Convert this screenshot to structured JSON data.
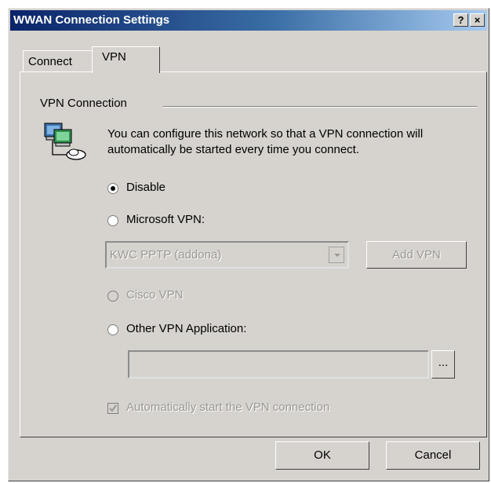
{
  "window": {
    "title": "WWAN Connection Settings",
    "help_label": "?",
    "close_label": "×"
  },
  "tabs": [
    {
      "label": "Connect"
    },
    {
      "label": "VPN"
    }
  ],
  "group": {
    "label": "VPN Connection",
    "description": "You can configure this network so that a VPN connection will automatically be started every time you connect."
  },
  "options": {
    "disable": {
      "label": "Disable",
      "selected": true
    },
    "microsoft_vpn": {
      "label": "Microsoft VPN:",
      "selected": false
    },
    "cisco_vpn": {
      "label": "Cisco VPN",
      "selected": false,
      "disabled": true
    },
    "other_vpn": {
      "label": "Other VPN Application:",
      "selected": false
    }
  },
  "vpn_select": {
    "value": "KWC PPTP (addona)",
    "disabled": true
  },
  "add_vpn_button": {
    "label": "Add VPN",
    "disabled": true
  },
  "other_app": {
    "value": "",
    "browse_label": "..."
  },
  "auto_start": {
    "label": "Automatically start the VPN connection",
    "checked": true,
    "disabled": true
  },
  "footer": {
    "ok_label": "OK",
    "cancel_label": "Cancel"
  }
}
